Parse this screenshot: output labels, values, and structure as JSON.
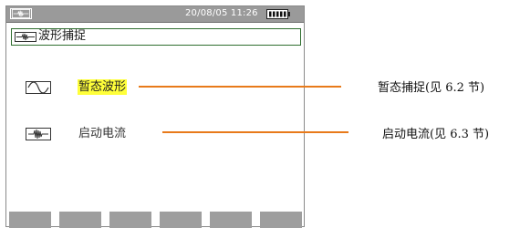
{
  "status": {
    "datetime": "20/08/05 11:26",
    "mode_icon": "waveform-mode-icon",
    "battery_icon": "battery-full-icon"
  },
  "title": {
    "icon": "waveform-capture-icon",
    "text": "波形捕捉"
  },
  "menu": [
    {
      "label": "暂态波形",
      "icon": "transient-wave-icon",
      "selected": true
    },
    {
      "label": "启动电流",
      "icon": "inrush-current-icon",
      "selected": false
    }
  ],
  "callouts": [
    {
      "text": "暂态捕捉(见 6.2 节)"
    },
    {
      "text": "启动电流(见 6.3 节)"
    }
  ],
  "softkeys": [
    "",
    "",
    "",
    "",
    "",
    ""
  ],
  "colors": {
    "status_bar": "#9a9a9a",
    "title_border": "#2f6e2f",
    "selection_highlight": "#ffff3a",
    "leader_line": "#e87a1a",
    "softkey": "#9e9e9e"
  }
}
